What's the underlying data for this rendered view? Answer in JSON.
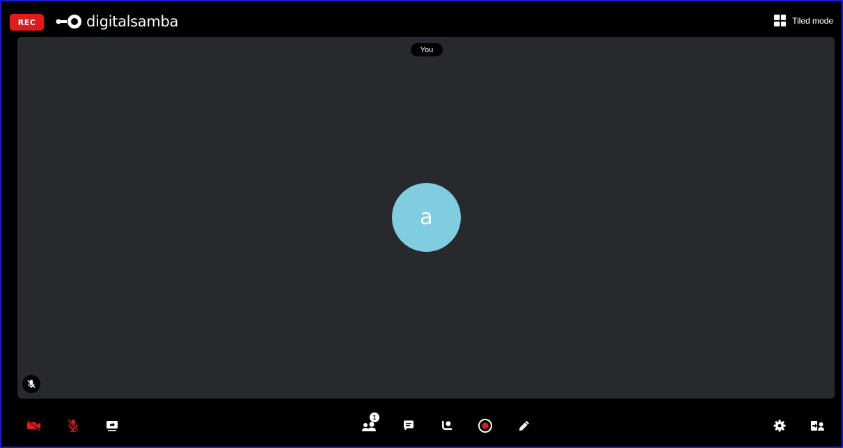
{
  "header": {
    "rec_label": "REC",
    "logo_text": "digitalsamba",
    "tiled_mode_label": "Tiled mode"
  },
  "stage": {
    "participant_label": "You",
    "avatar_initial": "a"
  },
  "toolbar": {
    "left": [
      {
        "name": "camera-off-icon",
        "color": "#e11b1b"
      },
      {
        "name": "mic-off-icon",
        "color": "#e11b1b"
      },
      {
        "name": "screen-share-icon",
        "color": "#ffffff"
      }
    ],
    "center": [
      {
        "name": "participants-icon",
        "badge": "1"
      },
      {
        "name": "chat-icon"
      },
      {
        "name": "raise-hand-icon"
      },
      {
        "name": "record-icon",
        "accent": "#e11b1b"
      },
      {
        "name": "whiteboard-pen-icon"
      }
    ],
    "right": [
      {
        "name": "settings-gear-icon"
      },
      {
        "name": "leave-room-icon"
      }
    ]
  },
  "colors": {
    "background": "#000000",
    "stage": "#27292d",
    "avatar": "#80cde0",
    "rec": "#e11b1b"
  }
}
